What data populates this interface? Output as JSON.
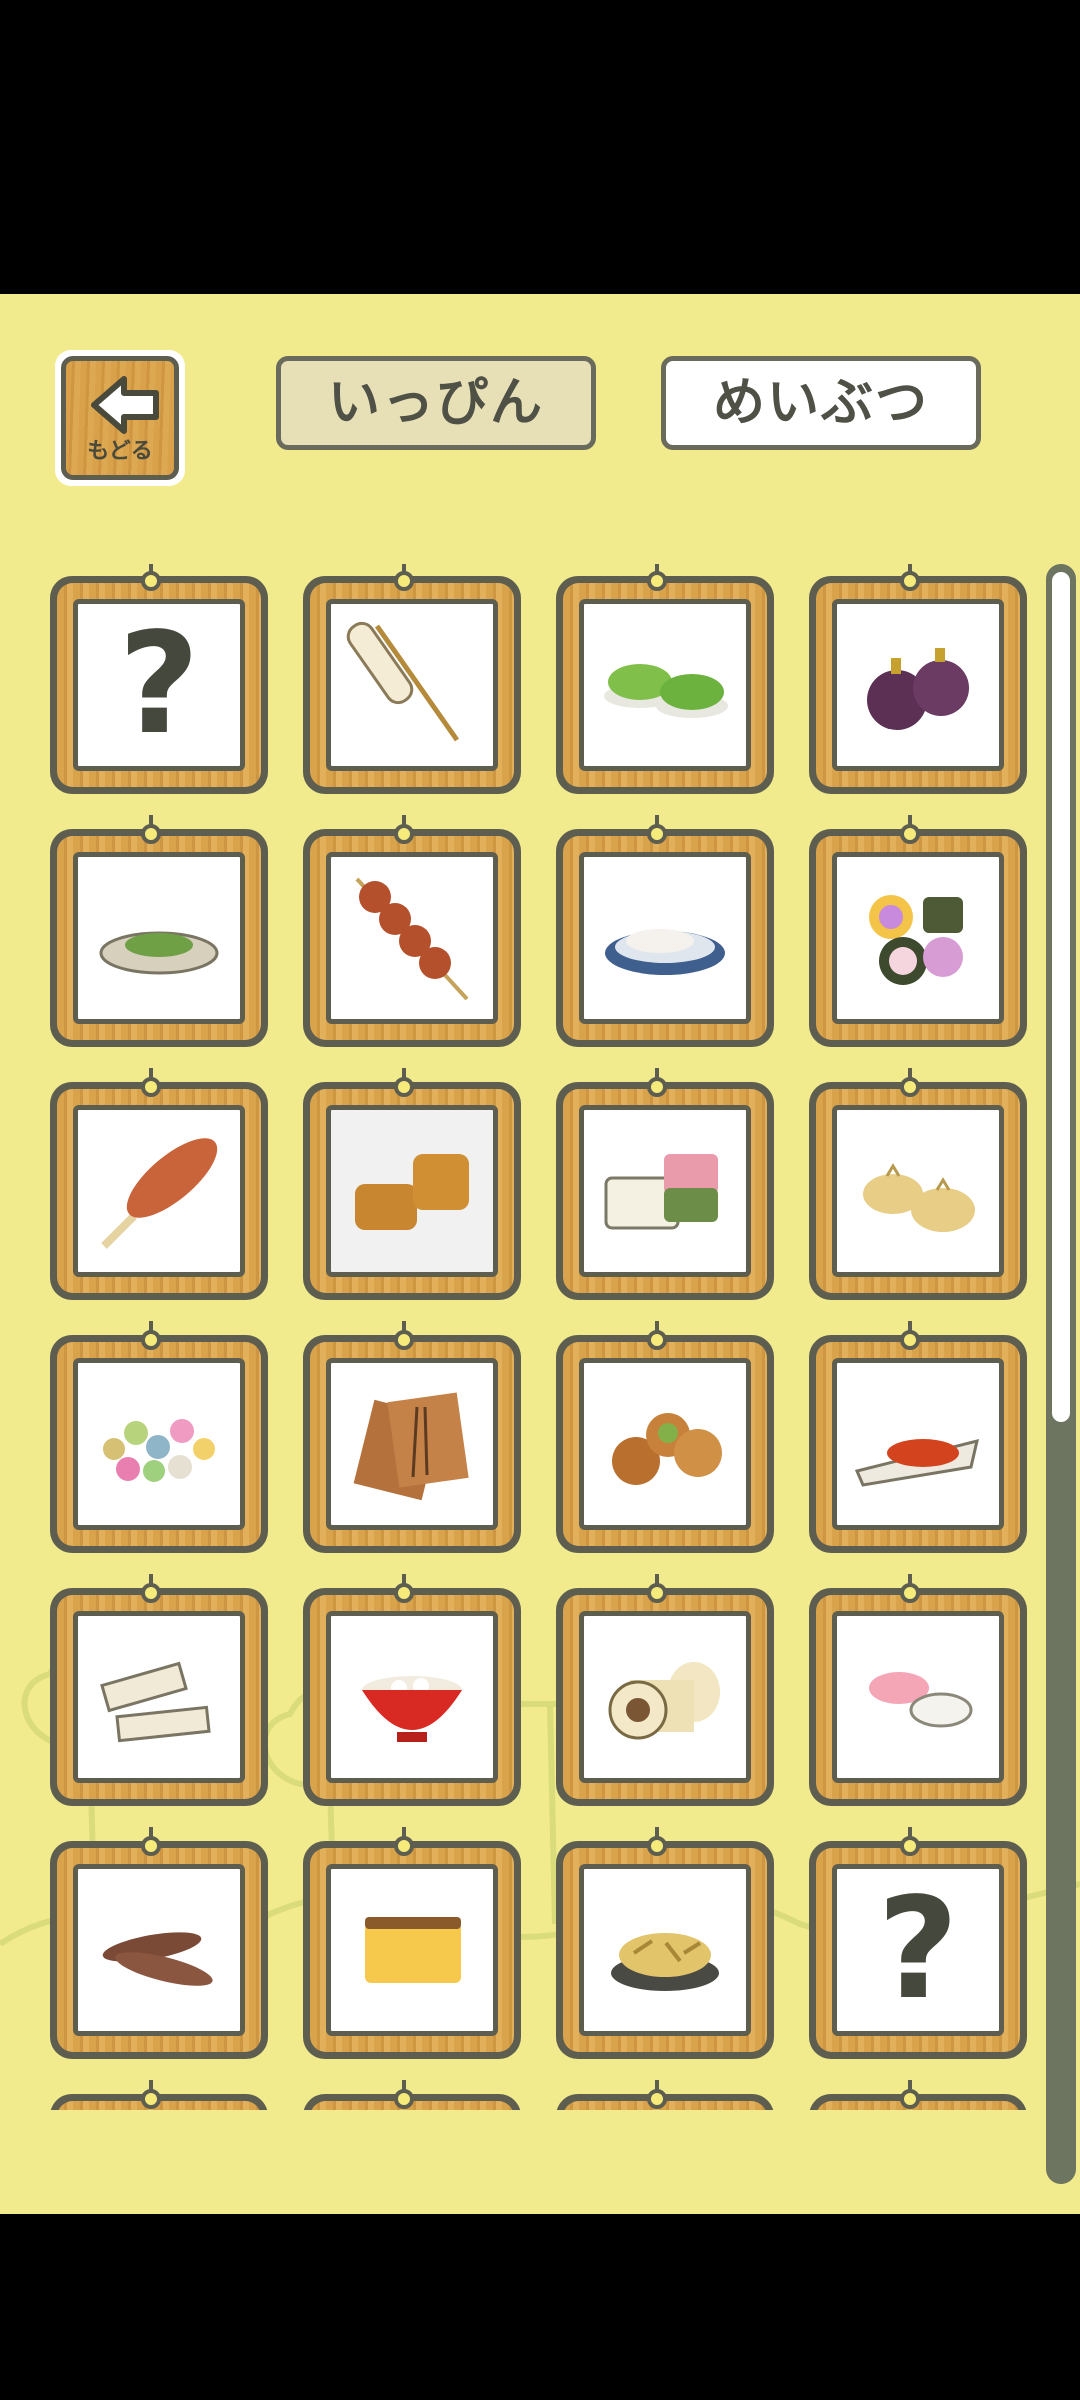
{
  "header": {
    "back_label": "もどる",
    "tabs": [
      {
        "label": "いっぴん",
        "selected": true
      },
      {
        "label": "めいぶつ",
        "selected": false
      }
    ]
  },
  "grid": {
    "unknown_mark": "?",
    "items": [
      {
        "icon": "unknown-item-icon",
        "known": false
      },
      {
        "icon": "skewer-stick-icon",
        "known": true
      },
      {
        "icon": "green-mochi-icon",
        "known": true
      },
      {
        "icon": "purple-fruit-pair-icon",
        "known": true
      },
      {
        "icon": "pickles-plate-icon",
        "known": true
      },
      {
        "icon": "dango-skewer-icon",
        "known": true
      },
      {
        "icon": "sliced-fish-plate-icon",
        "known": true
      },
      {
        "icon": "colorful-sushi-icon",
        "known": true
      },
      {
        "icon": "grilled-corn-dog-icon",
        "known": true
      },
      {
        "icon": "brown-square-sweets-icon",
        "known": true,
        "dimmed": true
      },
      {
        "icon": "layered-yokan-icon",
        "known": true
      },
      {
        "icon": "steamed-buns-icon",
        "known": true
      },
      {
        "icon": "colorful-candy-balls-icon",
        "known": true
      },
      {
        "icon": "senbei-packet-icon",
        "known": true
      },
      {
        "icon": "round-manju-icon",
        "known": true
      },
      {
        "icon": "red-fish-plate-icon",
        "known": true
      },
      {
        "icon": "sesame-bar-cakes-icon",
        "known": true
      },
      {
        "icon": "red-soup-bowl-icon",
        "known": true
      },
      {
        "icon": "roll-cake-icon",
        "known": true
      },
      {
        "icon": "flower-wagashi-icon",
        "known": true
      },
      {
        "icon": "brown-sticks-icon",
        "known": true
      },
      {
        "icon": "castella-cake-icon",
        "known": true
      },
      {
        "icon": "fried-snack-bowl-icon",
        "known": true
      },
      {
        "icon": "unknown-item-icon",
        "known": false
      },
      {
        "icon": "partial-item-icon",
        "known": true
      },
      {
        "icon": "partial-item-icon",
        "known": true
      },
      {
        "icon": "partial-item-icon",
        "known": true
      },
      {
        "icon": "partial-item-icon",
        "known": true
      }
    ]
  },
  "scroll": {
    "position_fraction": 0.0,
    "visible_fraction": 0.53
  },
  "colors": {
    "background": "#f1eb8d",
    "frame_wood": "#d9a34c",
    "outline": "#5d5e4f",
    "selected_tab": "#e7e0b6"
  }
}
